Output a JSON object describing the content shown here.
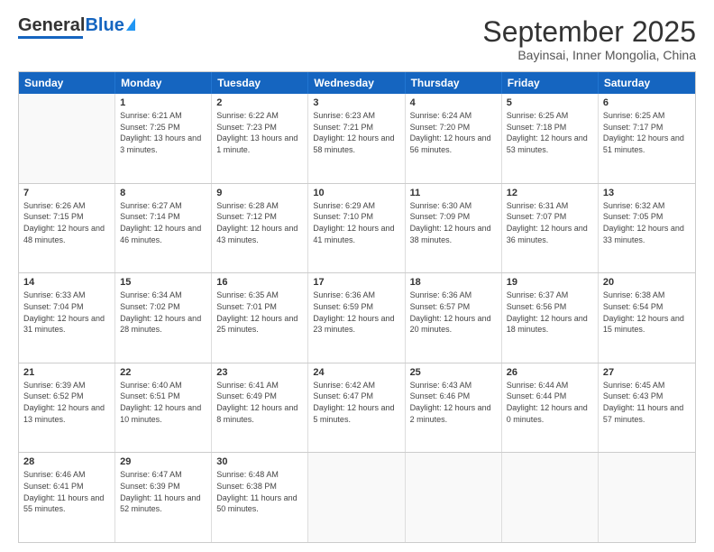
{
  "logo": {
    "general": "General",
    "blue": "Blue"
  },
  "title": "September 2025",
  "subtitle": "Bayinsai, Inner Mongolia, China",
  "header_days": [
    "Sunday",
    "Monday",
    "Tuesday",
    "Wednesday",
    "Thursday",
    "Friday",
    "Saturday"
  ],
  "weeks": [
    [
      {
        "day": "",
        "sunrise": "",
        "sunset": "",
        "daylight": ""
      },
      {
        "day": "1",
        "sunrise": "Sunrise: 6:21 AM",
        "sunset": "Sunset: 7:25 PM",
        "daylight": "Daylight: 13 hours and 3 minutes."
      },
      {
        "day": "2",
        "sunrise": "Sunrise: 6:22 AM",
        "sunset": "Sunset: 7:23 PM",
        "daylight": "Daylight: 13 hours and 1 minute."
      },
      {
        "day": "3",
        "sunrise": "Sunrise: 6:23 AM",
        "sunset": "Sunset: 7:21 PM",
        "daylight": "Daylight: 12 hours and 58 minutes."
      },
      {
        "day": "4",
        "sunrise": "Sunrise: 6:24 AM",
        "sunset": "Sunset: 7:20 PM",
        "daylight": "Daylight: 12 hours and 56 minutes."
      },
      {
        "day": "5",
        "sunrise": "Sunrise: 6:25 AM",
        "sunset": "Sunset: 7:18 PM",
        "daylight": "Daylight: 12 hours and 53 minutes."
      },
      {
        "day": "6",
        "sunrise": "Sunrise: 6:25 AM",
        "sunset": "Sunset: 7:17 PM",
        "daylight": "Daylight: 12 hours and 51 minutes."
      }
    ],
    [
      {
        "day": "7",
        "sunrise": "Sunrise: 6:26 AM",
        "sunset": "Sunset: 7:15 PM",
        "daylight": "Daylight: 12 hours and 48 minutes."
      },
      {
        "day": "8",
        "sunrise": "Sunrise: 6:27 AM",
        "sunset": "Sunset: 7:14 PM",
        "daylight": "Daylight: 12 hours and 46 minutes."
      },
      {
        "day": "9",
        "sunrise": "Sunrise: 6:28 AM",
        "sunset": "Sunset: 7:12 PM",
        "daylight": "Daylight: 12 hours and 43 minutes."
      },
      {
        "day": "10",
        "sunrise": "Sunrise: 6:29 AM",
        "sunset": "Sunset: 7:10 PM",
        "daylight": "Daylight: 12 hours and 41 minutes."
      },
      {
        "day": "11",
        "sunrise": "Sunrise: 6:30 AM",
        "sunset": "Sunset: 7:09 PM",
        "daylight": "Daylight: 12 hours and 38 minutes."
      },
      {
        "day": "12",
        "sunrise": "Sunrise: 6:31 AM",
        "sunset": "Sunset: 7:07 PM",
        "daylight": "Daylight: 12 hours and 36 minutes."
      },
      {
        "day": "13",
        "sunrise": "Sunrise: 6:32 AM",
        "sunset": "Sunset: 7:05 PM",
        "daylight": "Daylight: 12 hours and 33 minutes."
      }
    ],
    [
      {
        "day": "14",
        "sunrise": "Sunrise: 6:33 AM",
        "sunset": "Sunset: 7:04 PM",
        "daylight": "Daylight: 12 hours and 31 minutes."
      },
      {
        "day": "15",
        "sunrise": "Sunrise: 6:34 AM",
        "sunset": "Sunset: 7:02 PM",
        "daylight": "Daylight: 12 hours and 28 minutes."
      },
      {
        "day": "16",
        "sunrise": "Sunrise: 6:35 AM",
        "sunset": "Sunset: 7:01 PM",
        "daylight": "Daylight: 12 hours and 25 minutes."
      },
      {
        "day": "17",
        "sunrise": "Sunrise: 6:36 AM",
        "sunset": "Sunset: 6:59 PM",
        "daylight": "Daylight: 12 hours and 23 minutes."
      },
      {
        "day": "18",
        "sunrise": "Sunrise: 6:36 AM",
        "sunset": "Sunset: 6:57 PM",
        "daylight": "Daylight: 12 hours and 20 minutes."
      },
      {
        "day": "19",
        "sunrise": "Sunrise: 6:37 AM",
        "sunset": "Sunset: 6:56 PM",
        "daylight": "Daylight: 12 hours and 18 minutes."
      },
      {
        "day": "20",
        "sunrise": "Sunrise: 6:38 AM",
        "sunset": "Sunset: 6:54 PM",
        "daylight": "Daylight: 12 hours and 15 minutes."
      }
    ],
    [
      {
        "day": "21",
        "sunrise": "Sunrise: 6:39 AM",
        "sunset": "Sunset: 6:52 PM",
        "daylight": "Daylight: 12 hours and 13 minutes."
      },
      {
        "day": "22",
        "sunrise": "Sunrise: 6:40 AM",
        "sunset": "Sunset: 6:51 PM",
        "daylight": "Daylight: 12 hours and 10 minutes."
      },
      {
        "day": "23",
        "sunrise": "Sunrise: 6:41 AM",
        "sunset": "Sunset: 6:49 PM",
        "daylight": "Daylight: 12 hours and 8 minutes."
      },
      {
        "day": "24",
        "sunrise": "Sunrise: 6:42 AM",
        "sunset": "Sunset: 6:47 PM",
        "daylight": "Daylight: 12 hours and 5 minutes."
      },
      {
        "day": "25",
        "sunrise": "Sunrise: 6:43 AM",
        "sunset": "Sunset: 6:46 PM",
        "daylight": "Daylight: 12 hours and 2 minutes."
      },
      {
        "day": "26",
        "sunrise": "Sunrise: 6:44 AM",
        "sunset": "Sunset: 6:44 PM",
        "daylight": "Daylight: 12 hours and 0 minutes."
      },
      {
        "day": "27",
        "sunrise": "Sunrise: 6:45 AM",
        "sunset": "Sunset: 6:43 PM",
        "daylight": "Daylight: 11 hours and 57 minutes."
      }
    ],
    [
      {
        "day": "28",
        "sunrise": "Sunrise: 6:46 AM",
        "sunset": "Sunset: 6:41 PM",
        "daylight": "Daylight: 11 hours and 55 minutes."
      },
      {
        "day": "29",
        "sunrise": "Sunrise: 6:47 AM",
        "sunset": "Sunset: 6:39 PM",
        "daylight": "Daylight: 11 hours and 52 minutes."
      },
      {
        "day": "30",
        "sunrise": "Sunrise: 6:48 AM",
        "sunset": "Sunset: 6:38 PM",
        "daylight": "Daylight: 11 hours and 50 minutes."
      },
      {
        "day": "",
        "sunrise": "",
        "sunset": "",
        "daylight": ""
      },
      {
        "day": "",
        "sunrise": "",
        "sunset": "",
        "daylight": ""
      },
      {
        "day": "",
        "sunrise": "",
        "sunset": "",
        "daylight": ""
      },
      {
        "day": "",
        "sunrise": "",
        "sunset": "",
        "daylight": ""
      }
    ]
  ]
}
